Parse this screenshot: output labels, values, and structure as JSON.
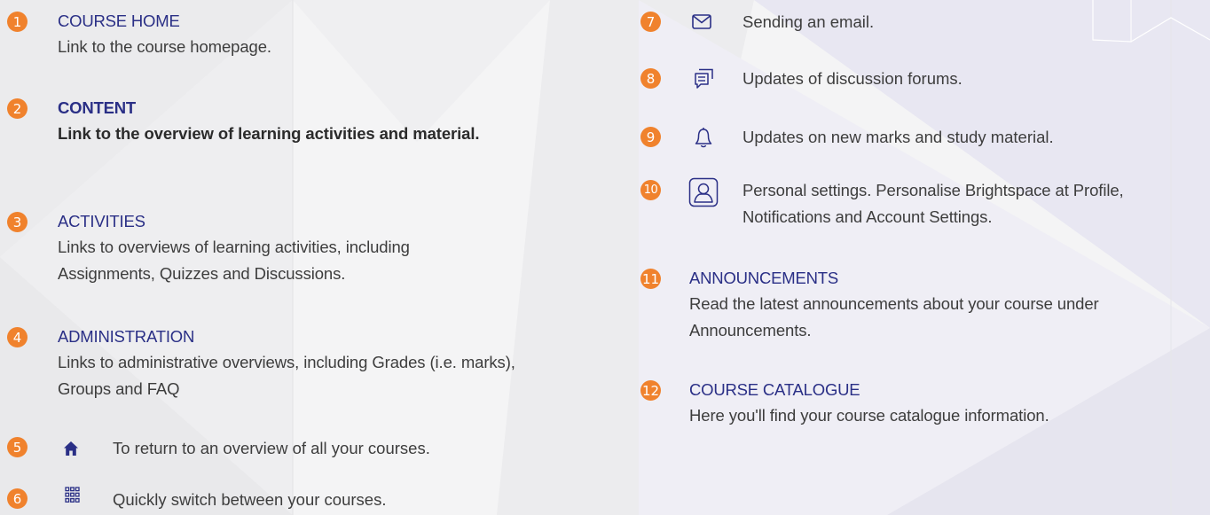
{
  "colors": {
    "badge": "#f0822d",
    "heading": "#2a2f86",
    "text": "#3d3d3d",
    "icon": "#2a2f86"
  },
  "left": [
    {
      "num": "1",
      "title": "COURSE HOME",
      "desc": "Link to the course homepage."
    },
    {
      "num": "2",
      "title": "CONTENT",
      "desc": "Link to the overview of learning activities and material."
    },
    {
      "num": "3",
      "title": "ACTIVITIES",
      "desc": "Links to overviews of learning activities, including Assignments, Quizzes and Discussions."
    },
    {
      "num": "4",
      "title": "ADMINISTRATION",
      "desc": "Links to administrative overviews, including Grades (i.e. marks), Groups and FAQ"
    },
    {
      "num": "5",
      "icon": "home-icon",
      "desc": "To return to an overview of all your courses."
    },
    {
      "num": "6",
      "icon": "grid-icon",
      "desc": "Quickly switch between your courses."
    }
  ],
  "right": [
    {
      "num": "7",
      "icon": "envelope-icon",
      "desc": "Sending an email."
    },
    {
      "num": "8",
      "icon": "chat-icon",
      "desc": "Updates of discussion forums."
    },
    {
      "num": "9",
      "icon": "bell-icon",
      "desc": "Updates on new marks and study material."
    },
    {
      "num": "10",
      "icon": "profile-icon",
      "desc": "Personal settings. Personalise Brightspace at Profile, Notifications and Account Settings."
    },
    {
      "num": "11",
      "title": "ANNOUNCEMENTS",
      "desc": "Read the latest announcements about your course under Announcements."
    },
    {
      "num": "12",
      "title": "COURSE CATALOGUE",
      "desc": "Here you'll find your course catalogue information."
    }
  ]
}
